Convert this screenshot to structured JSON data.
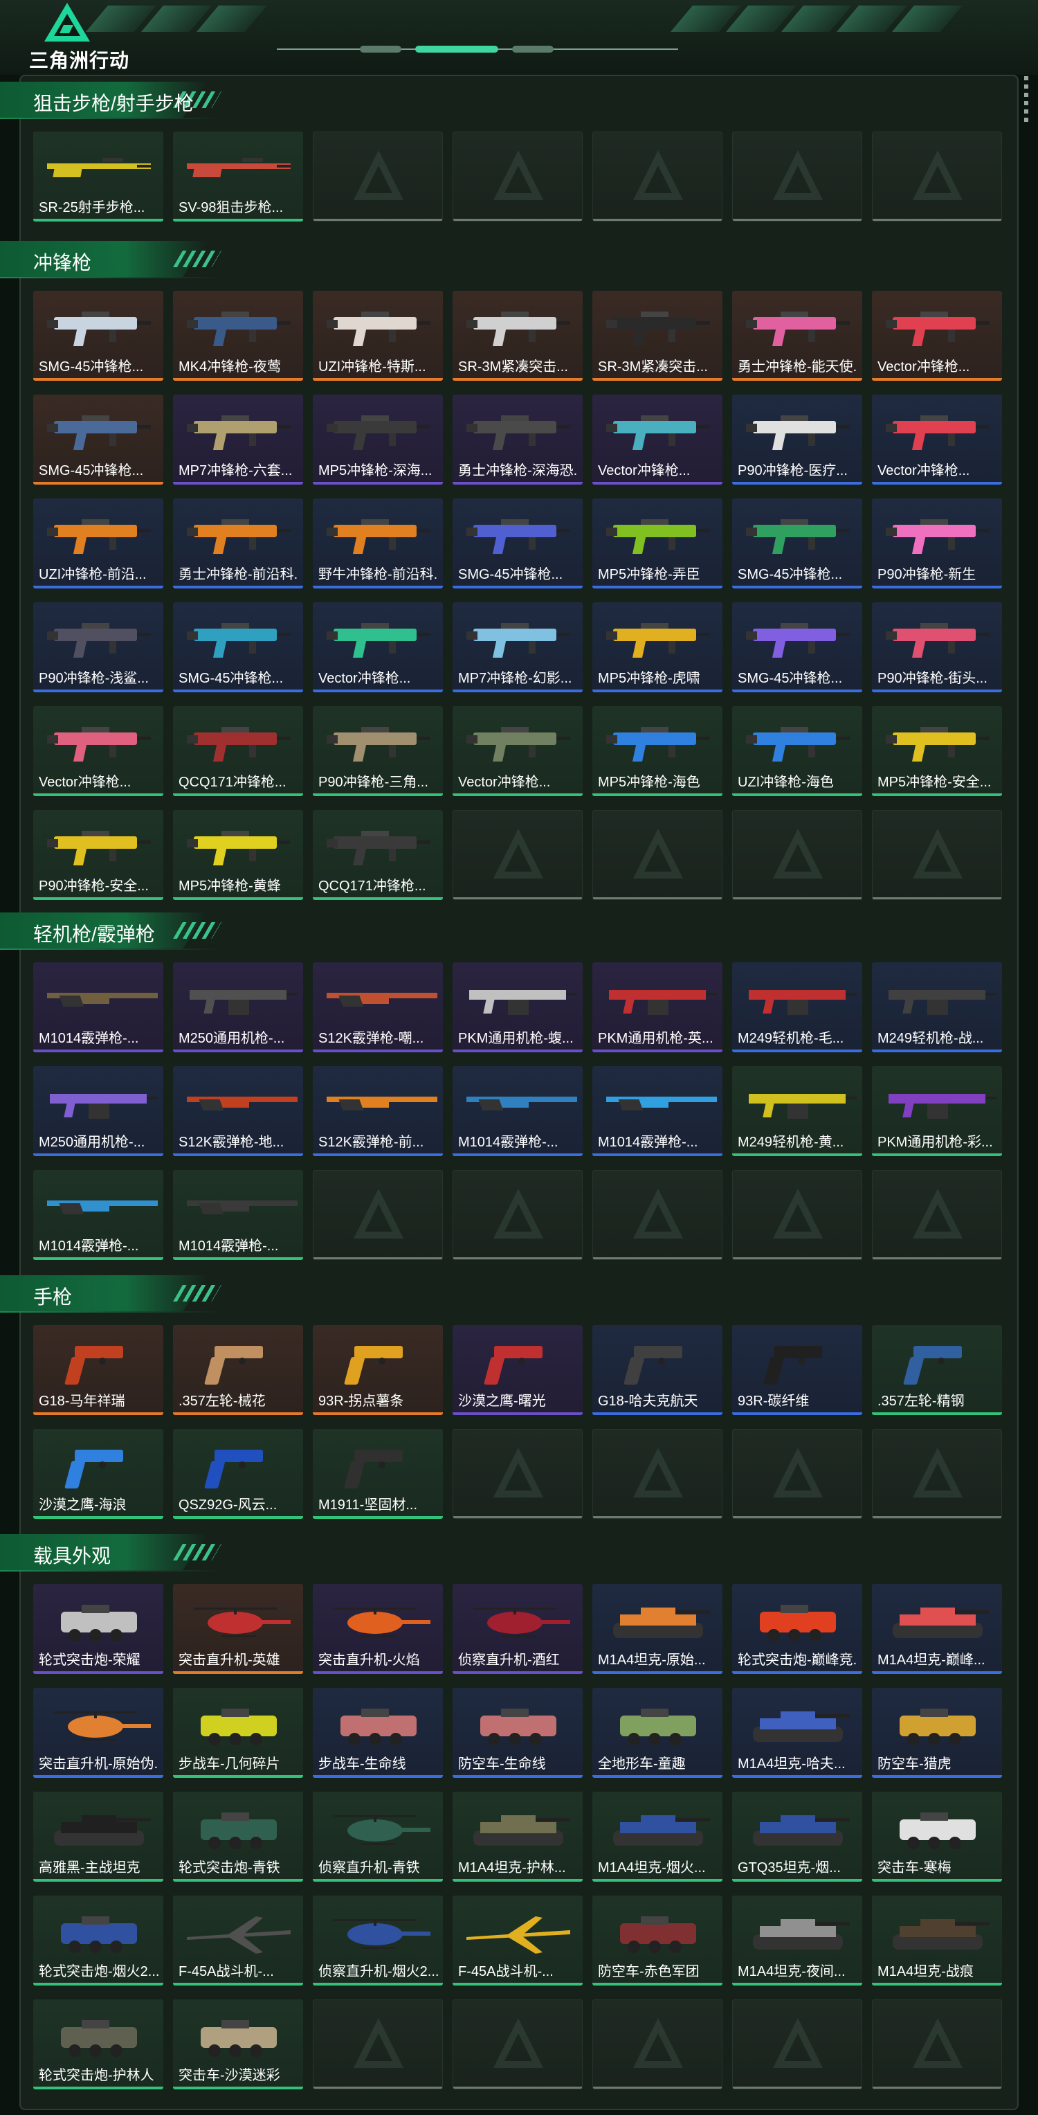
{
  "header": {
    "logo_text": "三角洲行动"
  },
  "colors": {
    "orange": "#e57a2a",
    "purple": "#6a50c8",
    "blue": "#3a6de0",
    "green": "#33c27a",
    "section_green": "#136b3d"
  },
  "sections": [
    {
      "title": "狙击步枪/射手步枪",
      "items": [
        {
          "label": "SR-25射手步枪...",
          "rarity": "green",
          "icon": "rifle-icon",
          "tint": "#d4c020"
        },
        {
          "label": "SV-98狙击步枪...",
          "rarity": "green",
          "icon": "rifle-icon",
          "tint": "#c94a3a"
        }
      ]
    },
    {
      "title": "冲锋枪",
      "items": [
        {
          "label": "SMG-45冲锋枪...",
          "rarity": "orange",
          "icon": "smg-icon",
          "tint": "#c8d4e0"
        },
        {
          "label": "MK4冲锋枪-夜莺",
          "rarity": "orange",
          "icon": "smg-icon",
          "tint": "#3a5a8a"
        },
        {
          "label": "UZI冲锋枪-特斯...",
          "rarity": "orange",
          "icon": "smg-icon",
          "tint": "#e0d8d0"
        },
        {
          "label": "SR-3M紧凑突击...",
          "rarity": "orange",
          "icon": "smg-icon",
          "tint": "#d0d0d0"
        },
        {
          "label": "SR-3M紧凑突击...",
          "rarity": "orange",
          "icon": "smg-icon",
          "tint": "#2a2a2a"
        },
        {
          "label": "勇士冲锋枪-能天使...",
          "rarity": "orange",
          "icon": "smg-icon",
          "tint": "#e060a0"
        },
        {
          "label": "Vector冲锋枪...",
          "rarity": "orange",
          "icon": "smg-icon",
          "tint": "#e04050"
        },
        {
          "label": "SMG-45冲锋枪...",
          "rarity": "orange",
          "icon": "smg-icon",
          "tint": "#4a6a9a"
        },
        {
          "label": "MP7冲锋枪-六套...",
          "rarity": "purple",
          "icon": "smg-icon",
          "tint": "#b0a070"
        },
        {
          "label": "MP5冲锋枪-深海...",
          "rarity": "purple",
          "icon": "smg-icon",
          "tint": "#3a3a3a"
        },
        {
          "label": "勇士冲锋枪-深海恐...",
          "rarity": "purple",
          "icon": "smg-icon",
          "tint": "#4a4a4a"
        },
        {
          "label": "Vector冲锋枪...",
          "rarity": "purple",
          "icon": "smg-icon",
          "tint": "#4ab0c0"
        },
        {
          "label": "P90冲锋枪-医疗...",
          "rarity": "blue",
          "icon": "smg-icon",
          "tint": "#e0e0e0"
        },
        {
          "label": "Vector冲锋枪...",
          "rarity": "blue",
          "icon": "smg-icon",
          "tint": "#e04050"
        },
        {
          "label": "UZI冲锋枪-前沿...",
          "rarity": "blue",
          "icon": "smg-icon",
          "tint": "#e08020"
        },
        {
          "label": "勇士冲锋枪-前沿科...",
          "rarity": "blue",
          "icon": "smg-icon",
          "tint": "#e08020"
        },
        {
          "label": "野牛冲锋枪-前沿科...",
          "rarity": "blue",
          "icon": "smg-icon",
          "tint": "#e08020"
        },
        {
          "label": "SMG-45冲锋枪...",
          "rarity": "blue",
          "icon": "smg-icon",
          "tint": "#5060d0"
        },
        {
          "label": "MP5冲锋枪-弄臣",
          "rarity": "blue",
          "icon": "smg-icon",
          "tint": "#80c020"
        },
        {
          "label": "SMG-45冲锋枪...",
          "rarity": "blue",
          "icon": "smg-icon",
          "tint": "#30a060"
        },
        {
          "label": "P90冲锋枪-新生",
          "rarity": "blue",
          "icon": "smg-icon",
          "tint": "#f070c0"
        },
        {
          "label": "P90冲锋枪-浅鲨...",
          "rarity": "blue",
          "icon": "smg-icon",
          "tint": "#505060"
        },
        {
          "label": "SMG-45冲锋枪...",
          "rarity": "blue",
          "icon": "smg-icon",
          "tint": "#30a0c0"
        },
        {
          "label": "Vector冲锋枪...",
          "rarity": "blue",
          "icon": "smg-icon",
          "tint": "#30c090"
        },
        {
          "label": "MP7冲锋枪-幻影...",
          "rarity": "blue",
          "icon": "smg-icon",
          "tint": "#80c0e0"
        },
        {
          "label": "MP5冲锋枪-虎啸",
          "rarity": "blue",
          "icon": "smg-icon",
          "tint": "#e0b020"
        },
        {
          "label": "SMG-45冲锋枪...",
          "rarity": "blue",
          "icon": "smg-icon",
          "tint": "#8060e0"
        },
        {
          "label": "P90冲锋枪-街头...",
          "rarity": "blue",
          "icon": "smg-icon",
          "tint": "#e05070"
        },
        {
          "label": "Vector冲锋枪...",
          "rarity": "green",
          "icon": "smg-icon",
          "tint": "#e06080"
        },
        {
          "label": "QCQ171冲锋枪...",
          "rarity": "green",
          "icon": "smg-icon",
          "tint": "#a03030"
        },
        {
          "label": "P90冲锋枪-三角...",
          "rarity": "green",
          "icon": "smg-icon",
          "tint": "#a09070"
        },
        {
          "label": "Vector冲锋枪...",
          "rarity": "green",
          "icon": "smg-icon",
          "tint": "#708060"
        },
        {
          "label": "MP5冲锋枪-海色",
          "rarity": "green",
          "icon": "smg-icon",
          "tint": "#3080e0"
        },
        {
          "label": "UZI冲锋枪-海色",
          "rarity": "green",
          "icon": "smg-icon",
          "tint": "#3080e0"
        },
        {
          "label": "MP5冲锋枪-安全...",
          "rarity": "green",
          "icon": "smg-icon",
          "tint": "#e0c020"
        },
        {
          "label": "P90冲锋枪-安全...",
          "rarity": "green",
          "icon": "smg-icon",
          "tint": "#e0c020"
        },
        {
          "label": "MP5冲锋枪-黄蜂",
          "rarity": "green",
          "icon": "smg-icon",
          "tint": "#e0d020"
        },
        {
          "label": "QCQ171冲锋枪...",
          "rarity": "green",
          "icon": "smg-icon",
          "tint": "#3a3a3a"
        }
      ]
    },
    {
      "title": "轻机枪/霰弹枪",
      "items": [
        {
          "label": "M1014霰弹枪-...",
          "rarity": "purple",
          "icon": "shotgun-icon",
          "tint": "#706040"
        },
        {
          "label": "M250通用机枪-...",
          "rarity": "purple",
          "icon": "lmg-icon",
          "tint": "#505050"
        },
        {
          "label": "S12K霰弹枪-嘲...",
          "rarity": "purple",
          "icon": "shotgun-icon",
          "tint": "#c05030"
        },
        {
          "label": "PKM通用机枪-蝮...",
          "rarity": "purple",
          "icon": "lmg-icon",
          "tint": "#c0c0c0"
        },
        {
          "label": "PKM通用机枪-英...",
          "rarity": "purple",
          "icon": "lmg-icon",
          "tint": "#c03030"
        },
        {
          "label": "M249轻机枪-毛...",
          "rarity": "blue",
          "icon": "lmg-icon",
          "tint": "#c03030"
        },
        {
          "label": "M249轻机枪-战...",
          "rarity": "blue",
          "icon": "lmg-icon",
          "tint": "#404040"
        },
        {
          "label": "M250通用机枪-...",
          "rarity": "blue",
          "icon": "lmg-icon",
          "tint": "#8060d0"
        },
        {
          "label": "S12K霰弹枪-地...",
          "rarity": "blue",
          "icon": "shotgun-icon",
          "tint": "#c04020"
        },
        {
          "label": "S12K霰弹枪-前...",
          "rarity": "blue",
          "icon": "shotgun-icon",
          "tint": "#e08020"
        },
        {
          "label": "M1014霰弹枪-...",
          "rarity": "blue",
          "icon": "shotgun-icon",
          "tint": "#3080c0"
        },
        {
          "label": "M1014霰弹枪-...",
          "rarity": "blue",
          "icon": "shotgun-icon",
          "tint": "#30a0e0"
        },
        {
          "label": "M249轻机枪-黄...",
          "rarity": "green",
          "icon": "lmg-icon",
          "tint": "#d0c020"
        },
        {
          "label": "PKM通用机枪-彩...",
          "rarity": "green",
          "icon": "lmg-icon",
          "tint": "#8040c0"
        },
        {
          "label": "M1014霰弹枪-...",
          "rarity": "green",
          "icon": "shotgun-icon",
          "tint": "#3090d0"
        },
        {
          "label": "M1014霰弹枪-...",
          "rarity": "green",
          "icon": "shotgun-icon",
          "tint": "#3a3a3a"
        }
      ]
    },
    {
      "title": "手枪",
      "items": [
        {
          "label": "G18-马年祥瑞",
          "rarity": "orange",
          "icon": "pistol-icon",
          "tint": "#c04020"
        },
        {
          "label": ".357左轮-械花",
          "rarity": "orange",
          "icon": "revolver-icon",
          "tint": "#c09060"
        },
        {
          "label": "93R-拐点薯条",
          "rarity": "orange",
          "icon": "pistol-icon",
          "tint": "#e0a020"
        },
        {
          "label": "沙漠之鹰-曙光",
          "rarity": "purple",
          "icon": "pistol-icon",
          "tint": "#c03030"
        },
        {
          "label": "G18-哈夫克航天",
          "rarity": "blue",
          "icon": "pistol-icon",
          "tint": "#404040"
        },
        {
          "label": "93R-碳纤维",
          "rarity": "blue",
          "icon": "pistol-icon",
          "tint": "#202020"
        },
        {
          "label": ".357左轮-精钢",
          "rarity": "green",
          "icon": "revolver-icon",
          "tint": "#3060a0"
        },
        {
          "label": "沙漠之鹰-海浪",
          "rarity": "green",
          "icon": "pistol-icon",
          "tint": "#3080e0"
        },
        {
          "label": "QSZ92G-风云...",
          "rarity": "green",
          "icon": "pistol-icon",
          "tint": "#2050c0"
        },
        {
          "label": "M1911-坚固材...",
          "rarity": "green",
          "icon": "pistol-icon",
          "tint": "#303030"
        }
      ]
    },
    {
      "title": "载具外观",
      "items": [
        {
          "label": "轮式突击炮-荣耀",
          "rarity": "purple",
          "icon": "vehicle-icon",
          "tint": "#c0c0c0"
        },
        {
          "label": "突击直升机-英雄",
          "rarity": "orange",
          "icon": "helicopter-icon",
          "tint": "#c03030"
        },
        {
          "label": "突击直升机-火焰",
          "rarity": "purple",
          "icon": "helicopter-icon",
          "tint": "#e06020"
        },
        {
          "label": "侦察直升机-酒红",
          "rarity": "purple",
          "icon": "helicopter-icon",
          "tint": "#a02030"
        },
        {
          "label": "M1A4坦克-原始...",
          "rarity": "blue",
          "icon": "tank-icon",
          "tint": "#e08030"
        },
        {
          "label": "轮式突击炮-巅峰竞...",
          "rarity": "blue",
          "icon": "vehicle-icon",
          "tint": "#e04020"
        },
        {
          "label": "M1A4坦克-巅峰...",
          "rarity": "blue",
          "icon": "tank-icon",
          "tint": "#e05050"
        },
        {
          "label": "突击直升机-原始伪...",
          "rarity": "blue",
          "icon": "helicopter-icon",
          "tint": "#e08030"
        },
        {
          "label": "步战车-几何碎片",
          "rarity": "green",
          "icon": "vehicle-icon",
          "tint": "#d0d020"
        },
        {
          "label": "步战车-生命线",
          "rarity": "blue",
          "icon": "vehicle-icon",
          "tint": "#c07070"
        },
        {
          "label": "防空车-生命线",
          "rarity": "blue",
          "icon": "vehicle-icon",
          "tint": "#c07070"
        },
        {
          "label": "全地形车-童趣",
          "rarity": "blue",
          "icon": "vehicle-icon",
          "tint": "#80a060"
        },
        {
          "label": "M1A4坦克-哈夫...",
          "rarity": "blue",
          "icon": "tank-icon",
          "tint": "#4060c0"
        },
        {
          "label": "防空车-猎虎",
          "rarity": "blue",
          "icon": "vehicle-icon",
          "tint": "#d0a030"
        },
        {
          "label": "高雅黑-主战坦克",
          "rarity": "green",
          "icon": "tank-icon",
          "tint": "#202020"
        },
        {
          "label": "轮式突击炮-青铁",
          "rarity": "green",
          "icon": "vehicle-icon",
          "tint": "#306050"
        },
        {
          "label": "侦察直升机-青铁",
          "rarity": "green",
          "icon": "helicopter-icon",
          "tint": "#306050"
        },
        {
          "label": "M1A4坦克-护林...",
          "rarity": "green",
          "icon": "tank-icon",
          "tint": "#707050"
        },
        {
          "label": "M1A4坦克-烟火...",
          "rarity": "green",
          "icon": "tank-icon",
          "tint": "#3050a0"
        },
        {
          "label": "GTQ35坦克-烟...",
          "rarity": "green",
          "icon": "tank-icon",
          "tint": "#3050a0"
        },
        {
          "label": "突击车-寒梅",
          "rarity": "green",
          "icon": "vehicle-icon",
          "tint": "#e0e0e0"
        },
        {
          "label": "轮式突击炮-烟火2...",
          "rarity": "green",
          "icon": "vehicle-icon",
          "tint": "#3050a0"
        },
        {
          "label": "F-45A战斗机-...",
          "rarity": "green",
          "icon": "jet-icon",
          "tint": "#505050"
        },
        {
          "label": "侦察直升机-烟火2...",
          "rarity": "green",
          "icon": "helicopter-icon",
          "tint": "#3050a0"
        },
        {
          "label": "F-45A战斗机-...",
          "rarity": "green",
          "icon": "jet-icon",
          "tint": "#e0b020"
        },
        {
          "label": "防空车-赤色军团",
          "rarity": "green",
          "icon": "vehicle-icon",
          "tint": "#803030"
        },
        {
          "label": "M1A4坦克-夜间...",
          "rarity": "green",
          "icon": "tank-icon",
          "tint": "#909090"
        },
        {
          "label": "M1A4坦克-战痕",
          "rarity": "green",
          "icon": "tank-icon",
          "tint": "#504030"
        },
        {
          "label": "轮式突击炮-护林人",
          "rarity": "green",
          "icon": "vehicle-icon",
          "tint": "#606050"
        },
        {
          "label": "突击车-沙漠迷彩",
          "rarity": "green",
          "icon": "vehicle-icon",
          "tint": "#b0a080"
        }
      ]
    }
  ]
}
